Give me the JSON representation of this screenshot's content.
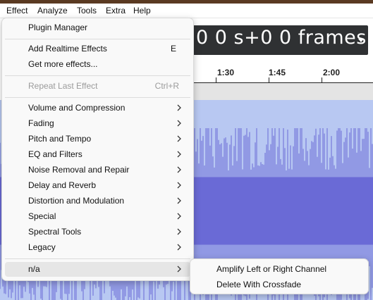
{
  "menubar": {
    "items": [
      "Effect",
      "Analyze",
      "Tools",
      "Extra",
      "Help"
    ]
  },
  "time_display": {
    "text": "0 0 s+0 0 frames"
  },
  "ruler": {
    "ticks": [
      "1:30",
      "1:45",
      "2:00"
    ]
  },
  "effect_menu": {
    "plugin_manager": "Plugin Manager",
    "add_realtime": "Add Realtime Effects",
    "add_realtime_shortcut": "E",
    "get_more": "Get more effects...",
    "repeat_last": "Repeat Last Effect",
    "repeat_last_shortcut": "Ctrl+R",
    "groups": [
      "Volume and Compression",
      "Fading",
      "Pitch and Tempo",
      "EQ and Filters",
      "Noise Removal and Repair",
      "Delay and Reverb",
      "Distortion and Modulation",
      "Special",
      "Spectral Tools",
      "Legacy"
    ],
    "na": "n/a"
  },
  "submenu": {
    "items": [
      "Amplify Left or Right Channel",
      "Delete With Crossfade"
    ]
  },
  "colors": {
    "waveform": "#6a6ad6",
    "track_bg": "#b8c8f2",
    "time_bg": "#2f3133",
    "title_strip": "#5a3a22"
  }
}
